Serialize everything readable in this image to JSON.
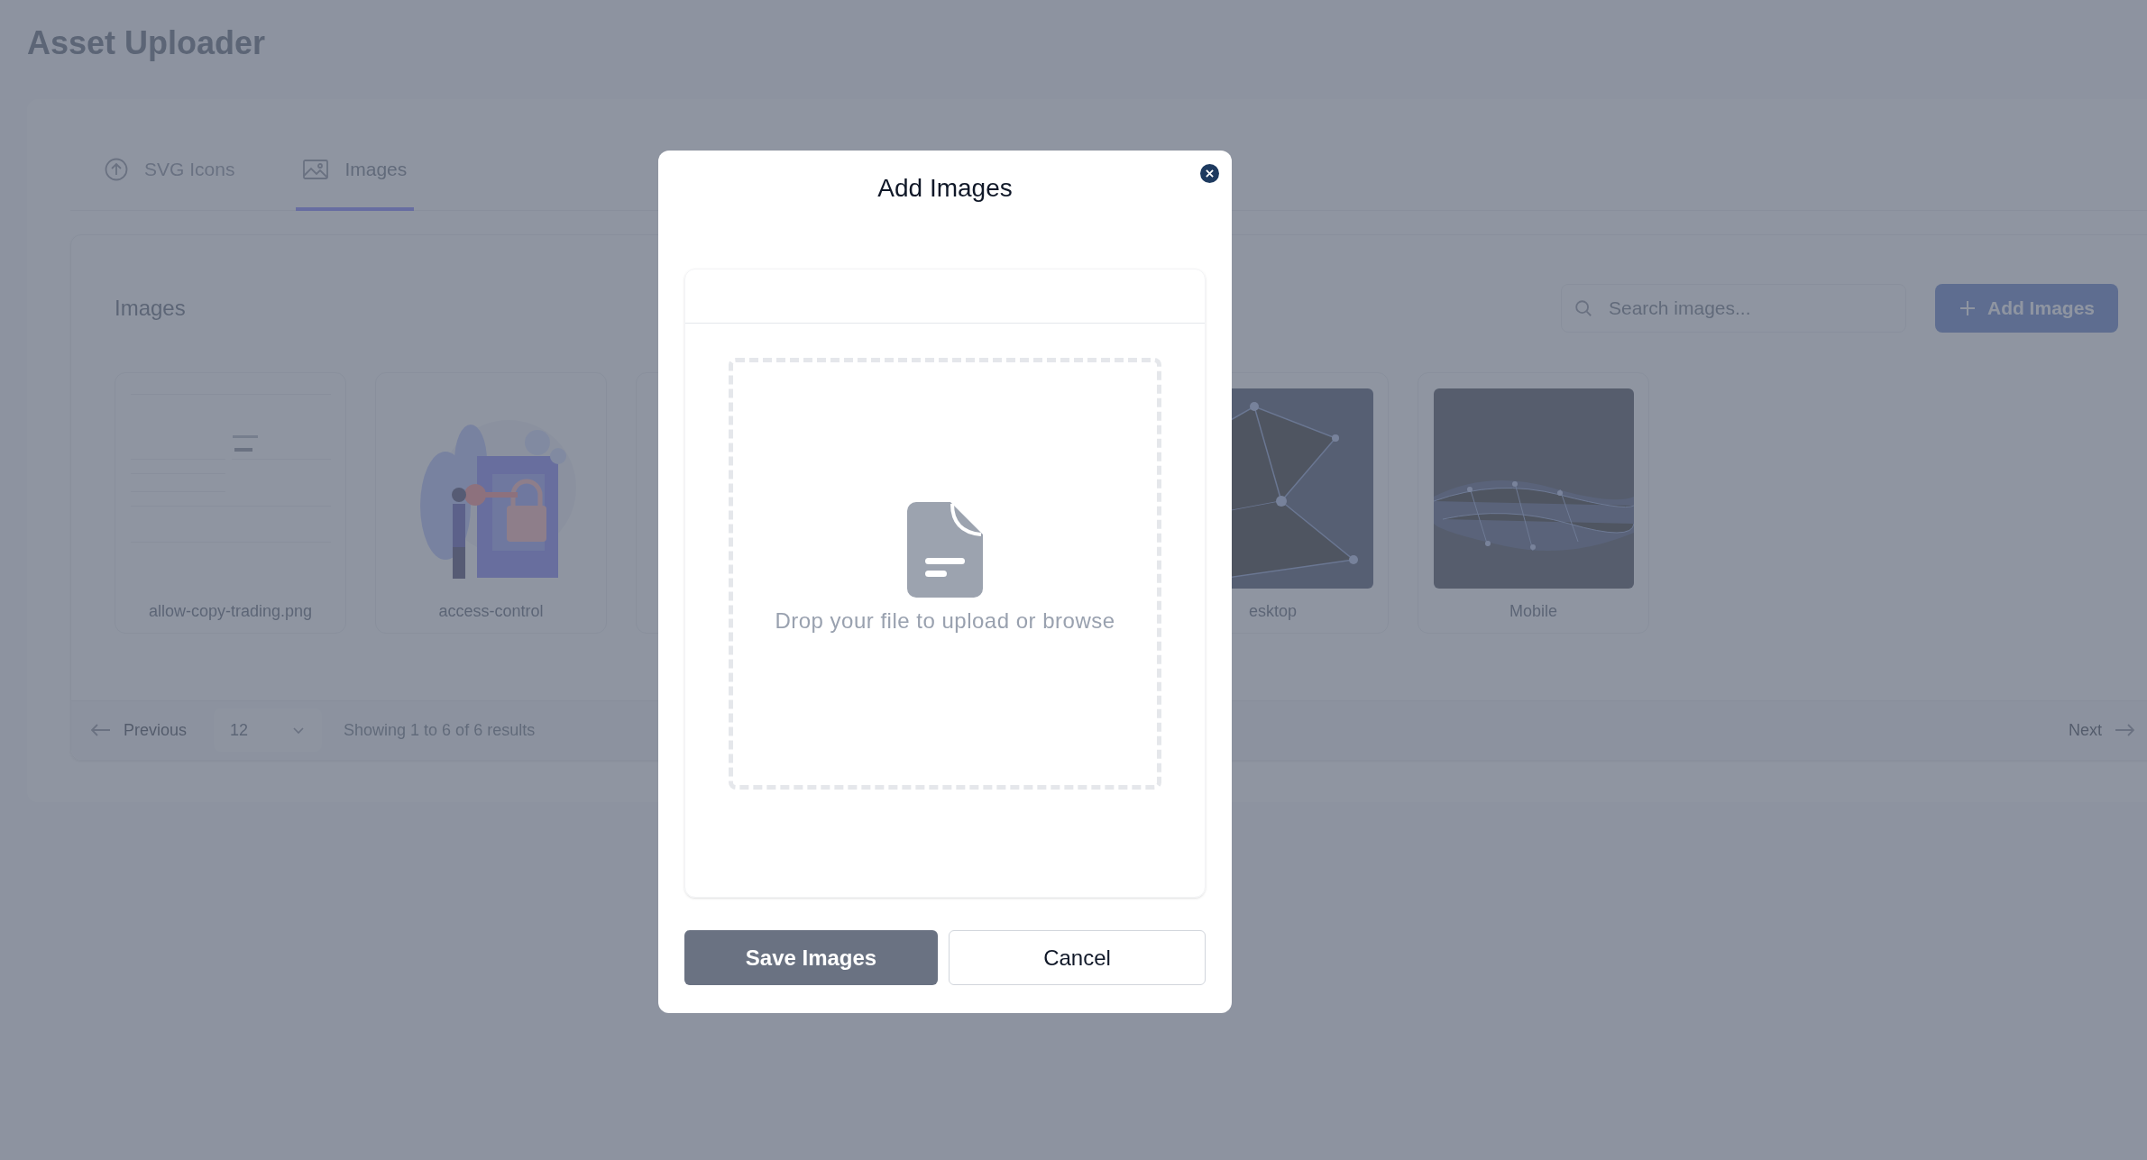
{
  "page": {
    "title": "Asset Uploader"
  },
  "tabs": [
    {
      "label": "SVG Icons",
      "selected": false
    },
    {
      "label": "Images",
      "selected": true
    }
  ],
  "panel": {
    "heading": "Images",
    "search": {
      "placeholder": "Search images..."
    },
    "add_button": "Add Images"
  },
  "images": [
    {
      "kind": "form",
      "label": "allow-copy-trading.png"
    },
    {
      "kind": "illustration",
      "label": "access-control"
    },
    {
      "kind": "covered"
    },
    {
      "kind": "network",
      "label": "esktop"
    },
    {
      "kind": "mesh",
      "label": "Mobile"
    }
  ],
  "pagination": {
    "previous": "Previous",
    "page_size": "12",
    "summary": "Showing 1 to 6 of 6 results",
    "next": "Next"
  },
  "modal": {
    "title": "Add Images",
    "dropzone_text": "Drop your file to upload or browse",
    "save_button": "Save Images",
    "cancel_button": "Cancel"
  }
}
